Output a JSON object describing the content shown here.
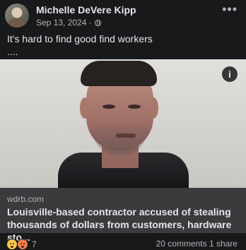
{
  "post": {
    "author": "Michelle DeVere Kipp",
    "date": "Sep 13, 2024",
    "separator": "·",
    "text_line1": "It's hard to find good find workers",
    "text_line2": "...."
  },
  "link": {
    "domain": "wdrb.com",
    "headline": "Louisville-based contractor accused of stealing thousands of dollars from customers, hardware sto..."
  },
  "engagement": {
    "reaction_count": "7",
    "comments_shares": "20 comments  1 share"
  },
  "icons": {
    "more": "more-icon",
    "globe": "globe-icon",
    "info": "info-icon",
    "reactions": [
      "wow-reaction-icon",
      "angry-reaction-icon"
    ]
  },
  "colors": {
    "background": "#18191a",
    "card": "#3a3b3c",
    "primary_text": "#e4e6eb",
    "secondary_text": "#b0b3b8"
  }
}
